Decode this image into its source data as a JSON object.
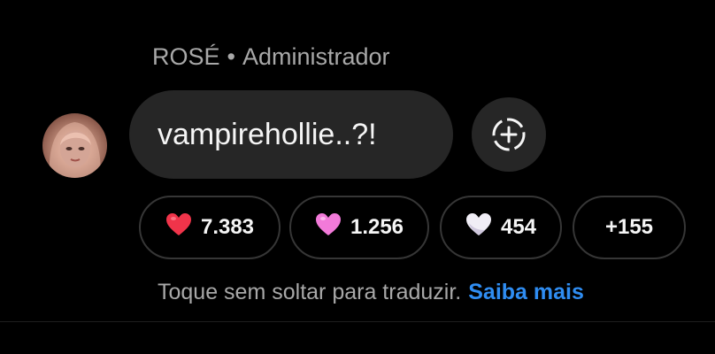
{
  "message": {
    "sender_name": "ROSÉ",
    "separator": "•",
    "sender_role": "Administrador",
    "text": "vampirehollie..?!"
  },
  "reactions": [
    {
      "emoji": "red-heart-icon",
      "color": "#f0344a",
      "count": "7.383"
    },
    {
      "emoji": "pink-heart-icon",
      "color": "#f27ad9",
      "count": "1.256"
    },
    {
      "emoji": "white-heart-icon",
      "color": "#f1eef6",
      "count": "454"
    },
    {
      "count": "+155"
    }
  ],
  "hint": {
    "text": "Toque sem soltar para traduzir.",
    "link": "Saiba mais"
  },
  "icons": {
    "add_reaction": "add-reaction-icon"
  },
  "colors": {
    "background": "#000000",
    "bubble": "#262626",
    "muted_text": "#a8a8a8",
    "link": "#2f8df2"
  }
}
